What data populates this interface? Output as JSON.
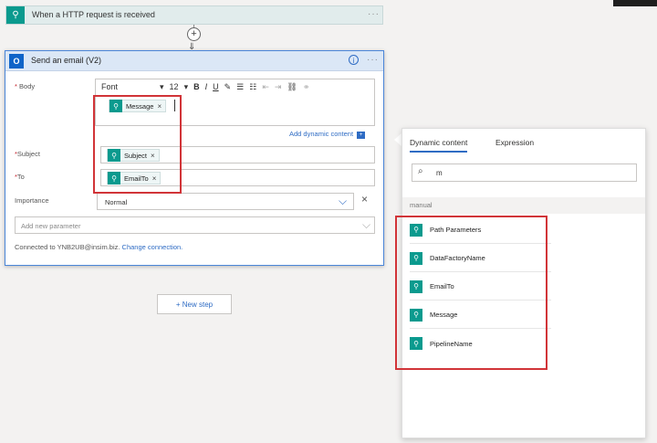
{
  "trigger": {
    "title": "When a HTTP request is received",
    "more": "···"
  },
  "action": {
    "title": "Send an email (V2)",
    "more": "···",
    "info": "i",
    "body_label": "Body",
    "toolbar": {
      "font": "Font",
      "size": "12",
      "bold": "B",
      "italic": "I",
      "underline": "U"
    },
    "body_token": "Message",
    "add_dynamic": "Add dynamic content",
    "subject_label": "Subject",
    "subject_token": "Subject",
    "to_label": "To",
    "to_token": "EmailTo",
    "importance_label": "Importance",
    "importance_value": "Normal",
    "add_param_placeholder": "Add new parameter",
    "connected_text": "Connected to YNB2UB@insim.biz.",
    "change_connection": "Change connection."
  },
  "new_step": "+ New step",
  "dynamic_panel": {
    "tabs": [
      "Dynamic content",
      "Expression"
    ],
    "search_value": "m",
    "section": "manual",
    "items": [
      "Path Parameters",
      "DataFactoryName",
      "EmailTo",
      "Message",
      "PipelineName"
    ]
  },
  "colors": {
    "teal": "#0a9a8e",
    "blue": "#2f6cc4",
    "highlight": "#d13438"
  }
}
